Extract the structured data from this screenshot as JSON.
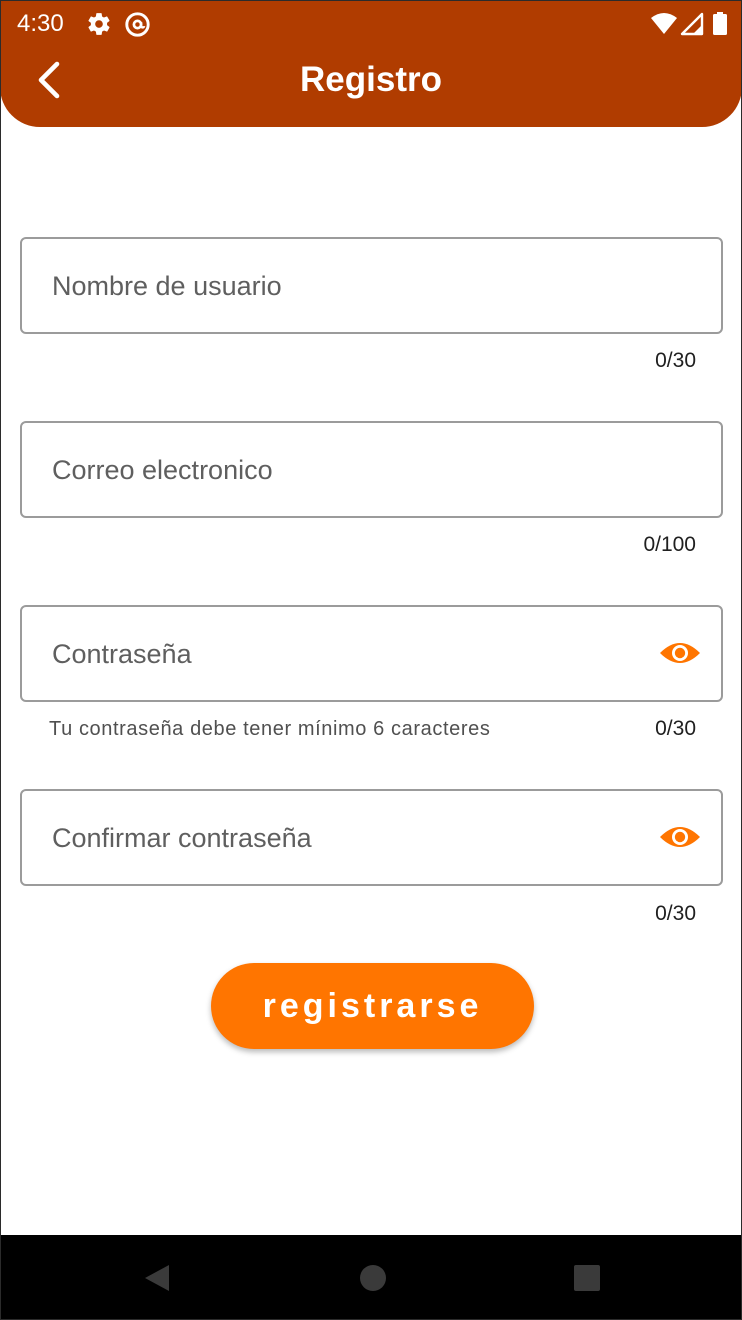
{
  "status_bar": {
    "time": "4:30",
    "left_icons": [
      "settings-icon",
      "at-sign-icon"
    ],
    "right_icons": [
      "wifi-icon",
      "signal-icon",
      "battery-icon"
    ]
  },
  "app_bar": {
    "title": "Registro",
    "back_icon": "chevron-left-icon",
    "background_color": "#b03c00"
  },
  "form": {
    "username": {
      "placeholder": "Nombre de usuario",
      "value": "",
      "counter": "0/30"
    },
    "email": {
      "placeholder": "Correo electronico",
      "value": "",
      "counter": "0/100"
    },
    "password": {
      "placeholder": "Contraseña",
      "value": "",
      "helper": "Tu contraseña debe tener mínimo 6 caracteres",
      "counter": "0/30",
      "toggle_icon": "eye-icon"
    },
    "confirm_password": {
      "placeholder": "Confirmar contraseña",
      "value": "",
      "counter": "0/30",
      "toggle_icon": "eye-icon"
    }
  },
  "register_button": {
    "label": "registrarse",
    "color": "#ff7500"
  },
  "nav_bar": {
    "icons": [
      "back-triangle-icon",
      "home-circle-icon",
      "recents-square-icon"
    ]
  }
}
